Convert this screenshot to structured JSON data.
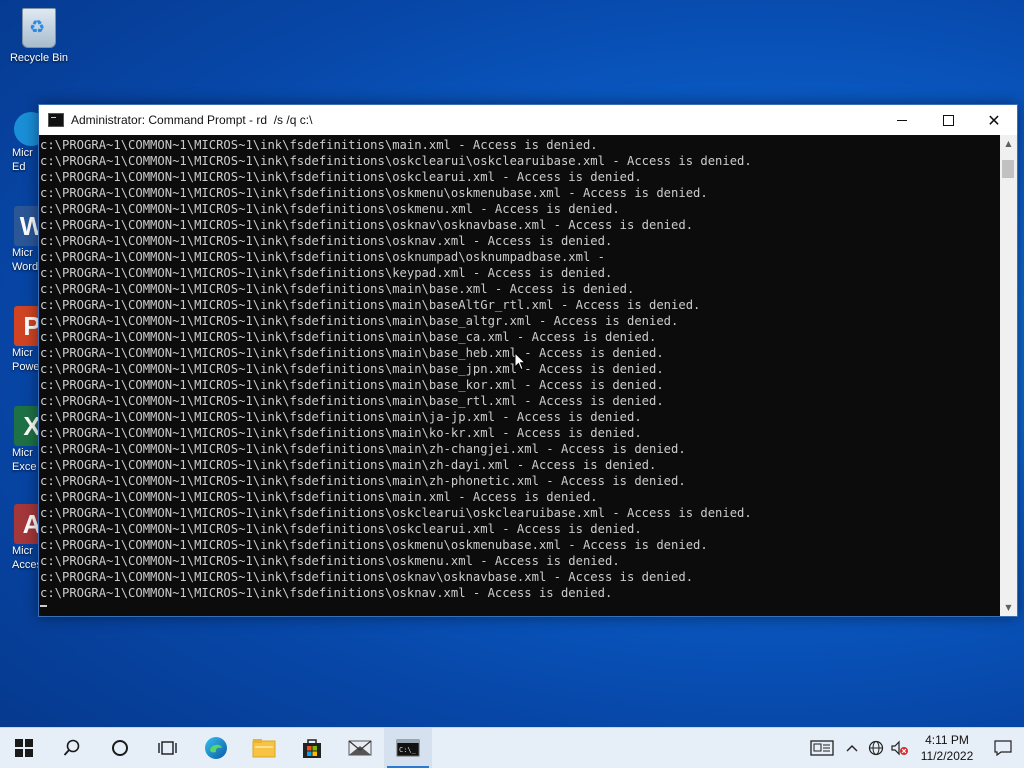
{
  "desktop": {
    "recycle_bin_label": "Recycle Bin",
    "partial_icons": [
      {
        "letter": "",
        "label_line1": "Micr",
        "label_line2": "Ed",
        "color": "#1a8fd8"
      },
      {
        "letter": "W",
        "label_line1": "Micr",
        "label_line2": "Word",
        "color": "#2b5797"
      },
      {
        "letter": "P",
        "label_line1": "Micr",
        "label_line2": "Powe",
        "color": "#d04423"
      },
      {
        "letter": "X",
        "label_line1": "Micr",
        "label_line2": "Exce",
        "color": "#1e7145"
      },
      {
        "letter": "A",
        "label_line1": "Micr",
        "label_line2": "Acces",
        "color": "#a4373a"
      }
    ]
  },
  "window": {
    "title": "Administrator: Command Prompt - rd  /s /q c:\\",
    "console_lines": [
      "c:\\PROGRA~1\\COMMON~1\\MICROS~1\\ink\\fsdefinitions\\main.xml - Access is denied.",
      "c:\\PROGRA~1\\COMMON~1\\MICROS~1\\ink\\fsdefinitions\\oskclearui\\oskclearuibase.xml - Access is denied.",
      "c:\\PROGRA~1\\COMMON~1\\MICROS~1\\ink\\fsdefinitions\\oskclearui.xml - Access is denied.",
      "c:\\PROGRA~1\\COMMON~1\\MICROS~1\\ink\\fsdefinitions\\oskmenu\\oskmenubase.xml - Access is denied.",
      "c:\\PROGRA~1\\COMMON~1\\MICROS~1\\ink\\fsdefinitions\\oskmenu.xml - Access is denied.",
      "c:\\PROGRA~1\\COMMON~1\\MICROS~1\\ink\\fsdefinitions\\osknav\\osknavbase.xml - Access is denied.",
      "c:\\PROGRA~1\\COMMON~1\\MICROS~1\\ink\\fsdefinitions\\osknav.xml - Access is denied.",
      "c:\\PROGRA~1\\COMMON~1\\MICROS~1\\ink\\fsdefinitions\\osknumpad\\osknumpadbase.xml -",
      "c:\\PROGRA~1\\COMMON~1\\MICROS~1\\ink\\fsdefinitions\\keypad.xml - Access is denied.",
      "c:\\PROGRA~1\\COMMON~1\\MICROS~1\\ink\\fsdefinitions\\main\\base.xml - Access is denied.",
      "c:\\PROGRA~1\\COMMON~1\\MICROS~1\\ink\\fsdefinitions\\main\\baseAltGr_rtl.xml - Access is denied.",
      "c:\\PROGRA~1\\COMMON~1\\MICROS~1\\ink\\fsdefinitions\\main\\base_altgr.xml - Access is denied.",
      "c:\\PROGRA~1\\COMMON~1\\MICROS~1\\ink\\fsdefinitions\\main\\base_ca.xml - Access is denied.",
      "c:\\PROGRA~1\\COMMON~1\\MICROS~1\\ink\\fsdefinitions\\main\\base_heb.xml - Access is denied.",
      "c:\\PROGRA~1\\COMMON~1\\MICROS~1\\ink\\fsdefinitions\\main\\base_jpn.xml - Access is denied.",
      "c:\\PROGRA~1\\COMMON~1\\MICROS~1\\ink\\fsdefinitions\\main\\base_kor.xml - Access is denied.",
      "c:\\PROGRA~1\\COMMON~1\\MICROS~1\\ink\\fsdefinitions\\main\\base_rtl.xml - Access is denied.",
      "c:\\PROGRA~1\\COMMON~1\\MICROS~1\\ink\\fsdefinitions\\main\\ja-jp.xml - Access is denied.",
      "c:\\PROGRA~1\\COMMON~1\\MICROS~1\\ink\\fsdefinitions\\main\\ko-kr.xml - Access is denied.",
      "c:\\PROGRA~1\\COMMON~1\\MICROS~1\\ink\\fsdefinitions\\main\\zh-changjei.xml - Access is denied.",
      "c:\\PROGRA~1\\COMMON~1\\MICROS~1\\ink\\fsdefinitions\\main\\zh-dayi.xml - Access is denied.",
      "c:\\PROGRA~1\\COMMON~1\\MICROS~1\\ink\\fsdefinitions\\main\\zh-phonetic.xml - Access is denied.",
      "c:\\PROGRA~1\\COMMON~1\\MICROS~1\\ink\\fsdefinitions\\main.xml - Access is denied.",
      "c:\\PROGRA~1\\COMMON~1\\MICROS~1\\ink\\fsdefinitions\\oskclearui\\oskclearuibase.xml - Access is denied.",
      "c:\\PROGRA~1\\COMMON~1\\MICROS~1\\ink\\fsdefinitions\\oskclearui.xml - Access is denied.",
      "c:\\PROGRA~1\\COMMON~1\\MICROS~1\\ink\\fsdefinitions\\oskmenu\\oskmenubase.xml - Access is denied.",
      "c:\\PROGRA~1\\COMMON~1\\MICROS~1\\ink\\fsdefinitions\\oskmenu.xml - Access is denied.",
      "c:\\PROGRA~1\\COMMON~1\\MICROS~1\\ink\\fsdefinitions\\osknav\\osknavbase.xml - Access is denied.",
      "c:\\PROGRA~1\\COMMON~1\\MICROS~1\\ink\\fsdefinitions\\osknav.xml - Access is denied."
    ]
  },
  "taskbar": {
    "items": [
      "start-icon",
      "search-icon",
      "cortana-icon",
      "task-view-icon",
      "edge-icon",
      "file-explorer-icon",
      "store-icon",
      "mail-icon",
      "command-prompt-icon"
    ],
    "clock_time": "4:11 PM",
    "clock_date": "11/2/2022"
  },
  "colors": {
    "console_bg": "#0c0c0c",
    "console_fg": "#cccccc",
    "taskbar_bg": "#e6eef7",
    "accent": "#2b7ad1"
  }
}
